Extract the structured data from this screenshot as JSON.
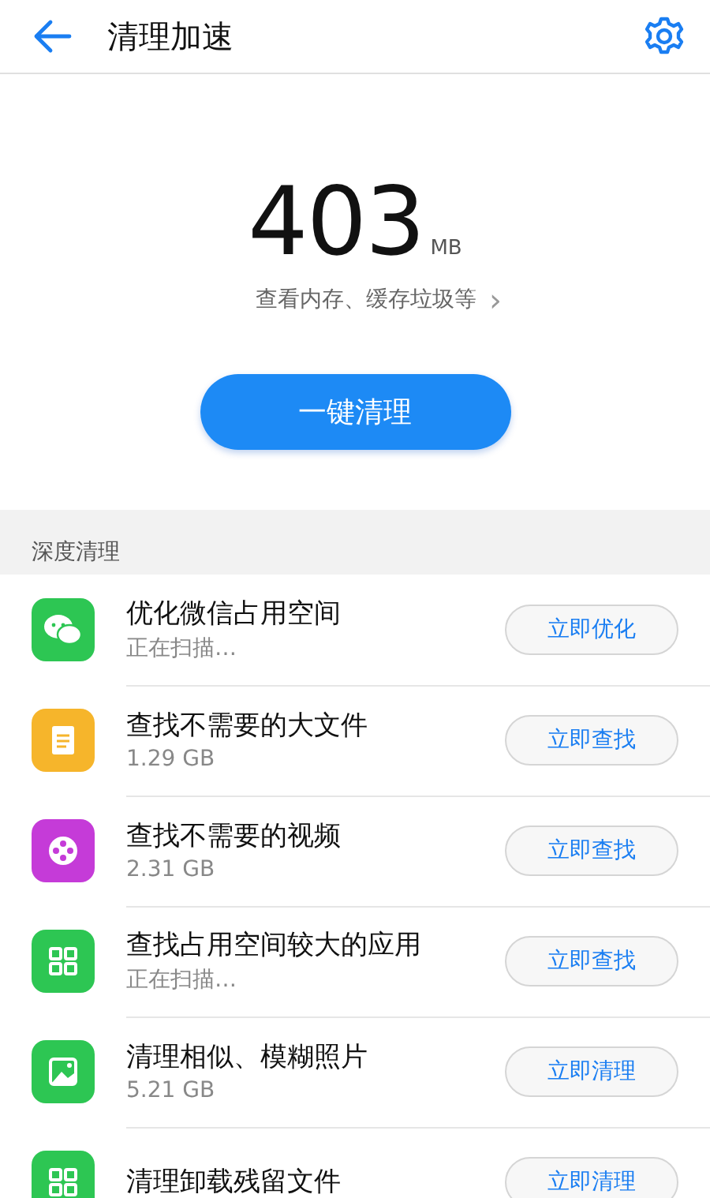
{
  "header": {
    "title": "清理加速"
  },
  "summary": {
    "amount": "403",
    "unit": "MB",
    "detail": "查看内存、缓存垃圾等",
    "detail_arrow": "›",
    "action": "一键清理"
  },
  "section": {
    "title": "深度清理"
  },
  "items": [
    {
      "kind": "chat",
      "color": "#2dc653",
      "title": "优化微信占用空间",
      "subtitle": "正在扫描…",
      "action": "立即优化"
    },
    {
      "kind": "document",
      "color": "#f6b52b",
      "title": "查找不需要的大文件",
      "subtitle": "1.29 GB",
      "action": "立即查找"
    },
    {
      "kind": "film",
      "color": "#c53bd8",
      "title": "查找不需要的视频",
      "subtitle": "2.31 GB",
      "action": "立即查找"
    },
    {
      "kind": "grid",
      "color": "#2dc653",
      "title": "查找占用空间较大的应用",
      "subtitle": "正在扫描…",
      "action": "立即查找"
    },
    {
      "kind": "photo",
      "color": "#2dc653",
      "title": "清理相似、模糊照片",
      "subtitle": "5.21 GB",
      "action": "立即清理"
    },
    {
      "kind": "grid",
      "color": "#2dc653",
      "title": "清理卸载残留文件",
      "action": "立即清理"
    }
  ]
}
